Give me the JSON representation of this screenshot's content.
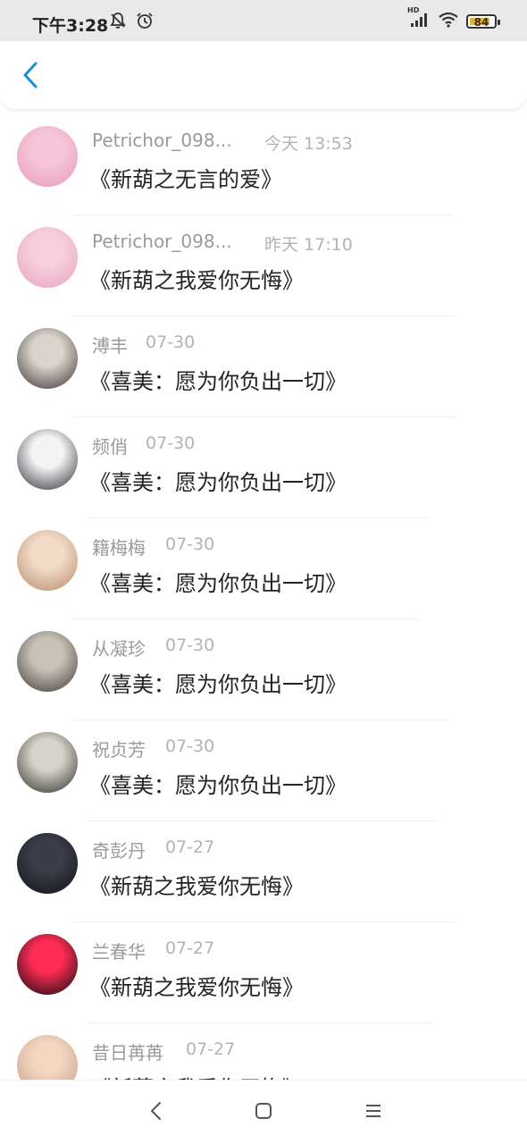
{
  "status_bar": {
    "time": "下午3:28",
    "network_label": "HD",
    "battery": "84",
    "battery_level": 0.84,
    "icons": [
      "mute-bell-icon",
      "alarm-clock-icon",
      "signal-icon",
      "wifi-icon",
      "battery-icon"
    ]
  },
  "header": {
    "back_icon": "chevron-left-icon",
    "accent_color": "#1a8fd6"
  },
  "items": [
    {
      "name": "Petrichor_098...",
      "time": "今天 13:53",
      "title": "《新葫之无言的爱》",
      "avatar_colors": [
        "#f6c6d8",
        "#e69ab8"
      ]
    },
    {
      "name": "Petrichor_098...",
      "time": "昨天 17:10",
      "title": "《新葫之我爱你无悔》",
      "avatar_colors": [
        "#f7cfdd",
        "#e8a2bd"
      ]
    },
    {
      "name": "溥丰",
      "time": "07-30",
      "title": "《喜美：愿为你负出一切》",
      "avatar_colors": [
        "#d9d4cc",
        "#3b3230"
      ]
    },
    {
      "name": "频俏",
      "time": "07-30",
      "title": "《喜美：愿为你负出一切》",
      "avatar_colors": [
        "#f4f4f4",
        "#2d2d35"
      ]
    },
    {
      "name": "籍梅梅",
      "time": "07-30",
      "title": "《喜美：愿为你负出一切》",
      "avatar_colors": [
        "#f1dcc8",
        "#b98a6a"
      ]
    },
    {
      "name": "从凝珍",
      "time": "07-30",
      "title": "《喜美：愿为你负出一切》",
      "avatar_colors": [
        "#c9c3b7",
        "#3e3a35"
      ]
    },
    {
      "name": "祝贞芳",
      "time": "07-30",
      "title": "《喜美：愿为你负出一切》",
      "avatar_colors": [
        "#d6d3c8",
        "#2f2d2a"
      ]
    },
    {
      "name": "奇彭丹",
      "time": "07-27",
      "title": "《新葫之我爱你无悔》",
      "avatar_colors": [
        "#3a3d4a",
        "#121318"
      ]
    },
    {
      "name": "兰春华",
      "time": "07-27",
      "title": "《新葫之我爱你无悔》",
      "avatar_colors": [
        "#ff2c56",
        "#0b0b0b"
      ]
    },
    {
      "name": "昔日苒苒",
      "time": "07-27",
      "title": "《新葫之我爱你无悔》",
      "avatar_colors": [
        "#f1d6c0",
        "#c79a8a"
      ]
    }
  ],
  "nav_bar": {
    "icons": [
      "nav-back-icon",
      "nav-home-icon",
      "nav-menu-icon"
    ]
  }
}
